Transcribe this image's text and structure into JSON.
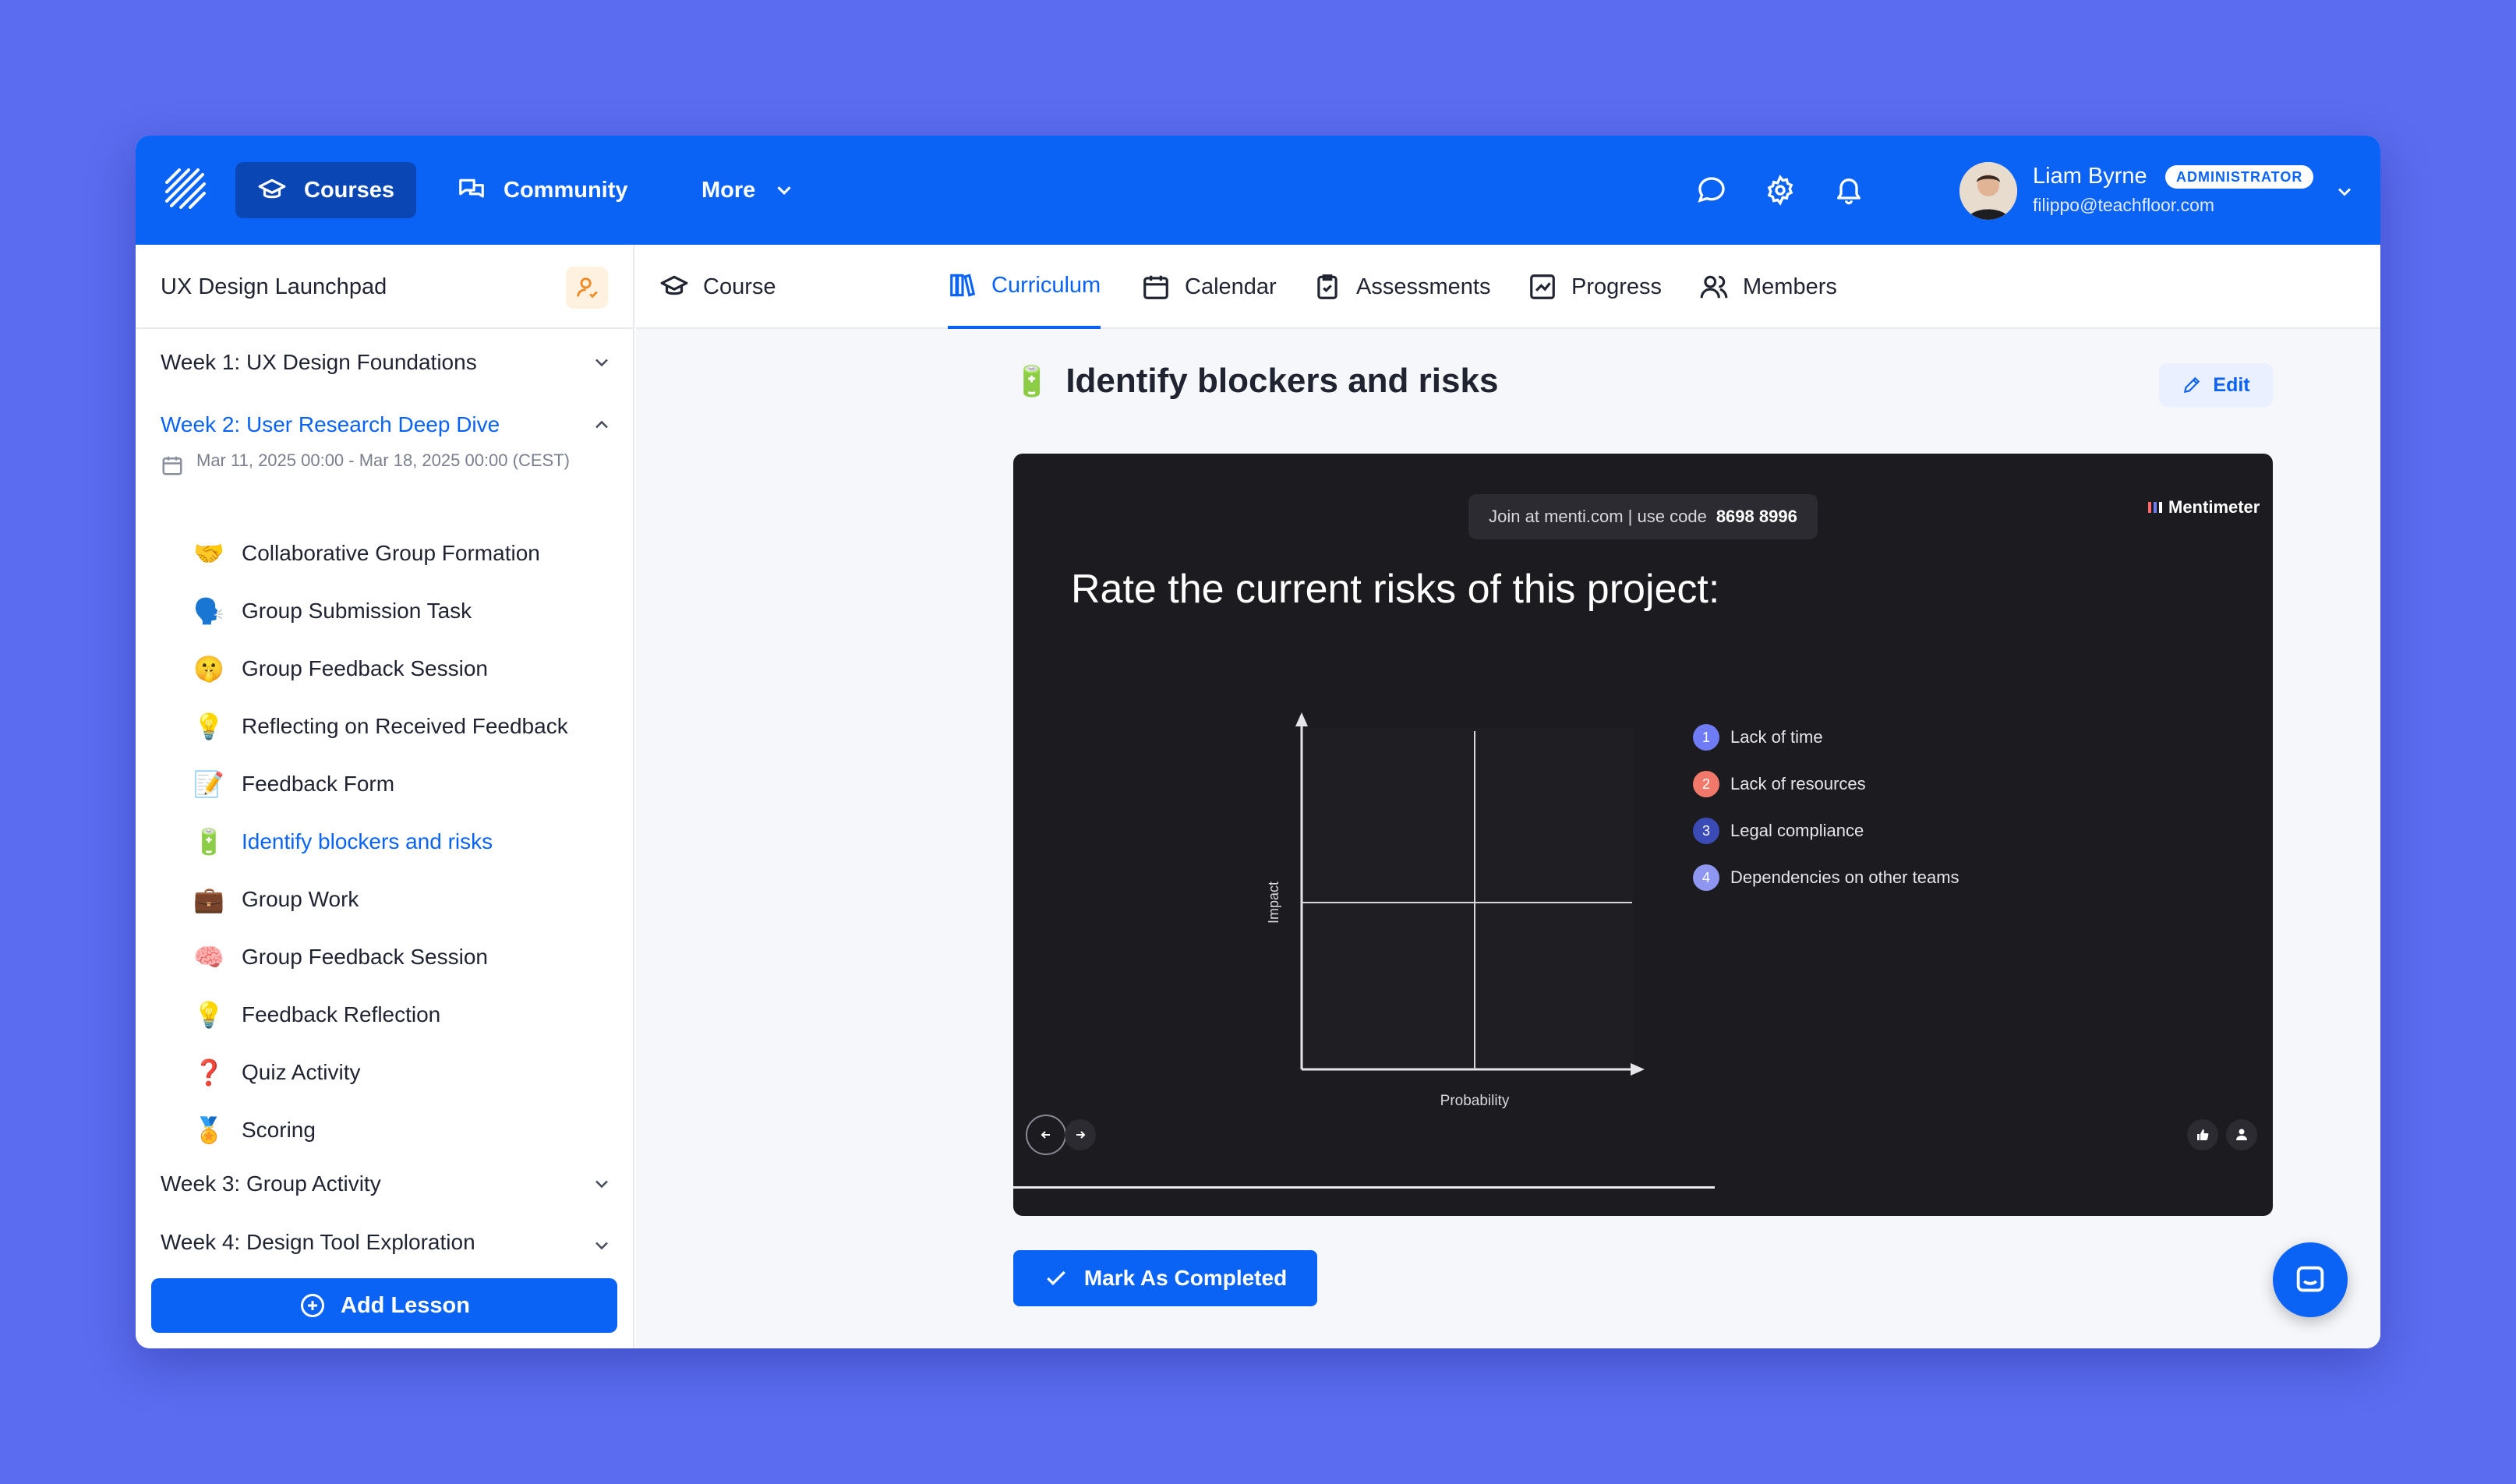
{
  "nav": {
    "courses_label": "Courses",
    "community_label": "Community",
    "more_label": "More"
  },
  "user": {
    "name": "Liam Byrne",
    "role_badge": "ADMINISTRATOR",
    "email": "filippo@teachfloor.com"
  },
  "sidebar": {
    "course_title": "UX Design Launchpad",
    "weeks": [
      {
        "label": "Week 1: UX Design Foundations",
        "expanded": false
      },
      {
        "label": "Week 2: User Research Deep Dive",
        "expanded": true,
        "date_range": "Mar 11, 2025 00:00 - Mar 18, 2025 00:00 (CEST)"
      },
      {
        "label": "Week 3: Group Activity",
        "expanded": false
      },
      {
        "label": "Week 4: Design Tool Exploration",
        "expanded": false
      }
    ],
    "lessons": [
      {
        "emoji": "🤝",
        "label": "Collaborative Group Formation"
      },
      {
        "emoji": "🗣️",
        "label": "Group Submission Task"
      },
      {
        "emoji": "🤫",
        "label": "Group Feedback Session"
      },
      {
        "emoji": "💡",
        "label": "Reflecting on Received Feedback"
      },
      {
        "emoji": "📝",
        "label": "Feedback Form"
      },
      {
        "emoji": "🔋",
        "label": "Identify blockers and risks"
      },
      {
        "emoji": "💼",
        "label": "Group Work"
      },
      {
        "emoji": "🧠",
        "label": "Group Feedback Session"
      },
      {
        "emoji": "💡",
        "label": "Feedback Reflection"
      },
      {
        "emoji": "❓",
        "label": "Quiz Activity"
      },
      {
        "emoji": "🏅",
        "label": "Scoring"
      }
    ],
    "add_lesson_label": "Add Lesson"
  },
  "tabs": [
    {
      "label": "Course"
    },
    {
      "label": "Curriculum"
    },
    {
      "label": "Calendar"
    },
    {
      "label": "Assessments"
    },
    {
      "label": "Progress"
    },
    {
      "label": "Members"
    }
  ],
  "lesson": {
    "emoji": "🔋",
    "title": "Identify blockers and risks",
    "edit_label": "Edit",
    "complete_label": "Mark As Completed"
  },
  "embed": {
    "join_text": "Join at menti.com | use code",
    "join_code": "8698 8996",
    "brand": "Mentimeter",
    "question": "Rate the current risks of this project:",
    "y_label": "Impact",
    "x_label": "Probability",
    "legend": [
      {
        "num": "1",
        "label": "Lack of time",
        "color": "#6f7cf5"
      },
      {
        "num": "2",
        "label": "Lack of resources",
        "color": "#f2786b"
      },
      {
        "num": "3",
        "label": "Legal compliance",
        "color": "#3a4bb5"
      },
      {
        "num": "4",
        "label": "Dependencies on other teams",
        "color": "#8e96f0"
      }
    ]
  },
  "colors": {
    "background": "#5b6cf0",
    "primary": "#0a63f5",
    "primary_dark": "#0a47b5"
  }
}
